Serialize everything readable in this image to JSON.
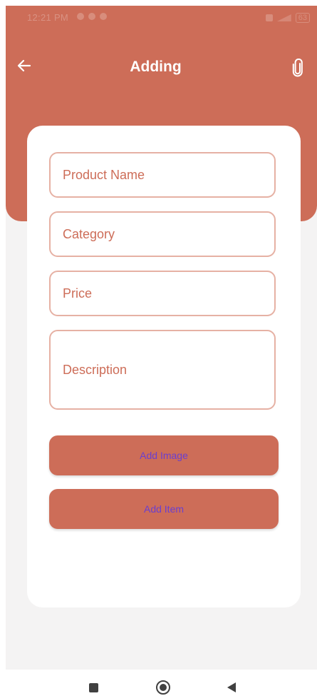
{
  "status_bar": {
    "time": "12:21 PM",
    "battery": "63"
  },
  "app_bar": {
    "title": "Adding",
    "back_icon": "arrow-left-icon",
    "attach_icon": "paperclip-icon"
  },
  "form": {
    "fields": [
      {
        "placeholder": "Product Name",
        "value": ""
      },
      {
        "placeholder": "Category",
        "value": ""
      },
      {
        "placeholder": "Price",
        "value": ""
      },
      {
        "placeholder": "Description",
        "value": ""
      }
    ],
    "add_image_label": "Add Image",
    "add_item_label": "Add Item"
  },
  "nav_bar": {
    "recents_icon": "square-icon",
    "home_icon": "circle-home-icon",
    "back_icon": "triangle-back-icon"
  },
  "colors": {
    "primary": "#cd6d58",
    "field_border": "#e6b1a4",
    "button_text": "#6a3fcf",
    "background": "#f4f3f3",
    "card": "#ffffff"
  }
}
